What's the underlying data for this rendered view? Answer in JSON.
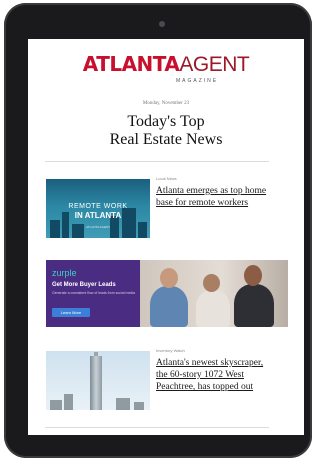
{
  "masthead": {
    "brand_part1": "ATLANTA",
    "brand_part2": "AGENT",
    "brand_sub": "MAGAZINE"
  },
  "newsletter": {
    "date": "Monday, November 23",
    "headline_line1": "Today's Top",
    "headline_line2": "Real Estate News"
  },
  "articles": [
    {
      "category": "Local News",
      "title": "Atlanta emerges as top home base for remote workers",
      "image_text_line1": "REMOTE WORK",
      "image_text_line2": "IN ATLANTA",
      "image_brand": "ATLANTA AGENT"
    },
    {
      "category": "Inventory Watch",
      "title": "Atlanta's newest skyscraper, the 60-story 1072 West Peachtree, has topped out"
    }
  ],
  "ad": {
    "brand": "zurple",
    "headline": "Get More Buyer Leads",
    "subtext": "Generate a consistent flow of leads from social media",
    "button_label": "Learn More"
  },
  "colors": {
    "brand_red": "#c8102e",
    "ad_purple": "#4a2c82",
    "ad_teal": "#3bd1c8",
    "tablet_frame": "#1a1a1c"
  }
}
